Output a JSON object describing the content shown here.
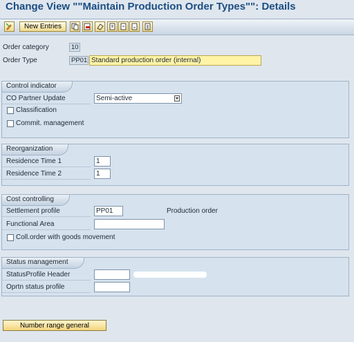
{
  "window": {
    "title": "Change View \"\"Maintain Production Order Types\"\": Details"
  },
  "toolbar": {
    "new_entries_label": "New Entries",
    "icons": [
      "edit-toggle-icon",
      "copy-icon",
      "delete-icon",
      "undo-icon",
      "first-entry-icon",
      "previous-entry-icon",
      "next-entry-icon",
      "last-entry-icon"
    ]
  },
  "header": {
    "order_category_label": "Order category",
    "order_category_value": "10",
    "order_type_label": "Order Type",
    "order_type_value": "PP01",
    "order_type_desc": "Standard production order (internal)"
  },
  "control_indicator": {
    "title": "Control indicator",
    "co_partner_label": "CO Partner Update",
    "co_partner_value": "Semi-active",
    "classification_label": "Classification",
    "classification_checked": false,
    "commit_label": "Commit. management",
    "commit_checked": false
  },
  "reorganization": {
    "title": "Reorganization",
    "res1_label": "Residence Time 1",
    "res1_value": "1",
    "res2_label": "Residence Time 2",
    "res2_value": "1"
  },
  "cost_controlling": {
    "title": "Cost controlling",
    "settlement_label": "Settlement profile",
    "settlement_value": "PP01",
    "settlement_desc": "Production order",
    "functional_label": "Functional Area",
    "functional_value": "",
    "coll_order_label": "Coll.order with goods movement",
    "coll_order_checked": false
  },
  "status_management": {
    "title": "Status management",
    "header_label": "StatusProfile Header",
    "header_value": "",
    "oprtn_label": "Oprtn status profile",
    "oprtn_value": ""
  },
  "footer": {
    "number_range_label": "Number range general"
  },
  "colors": {
    "title": "#1c4e82",
    "background": "#dfe6ee",
    "group": "#d6e2ee",
    "highlight": "#fff3a6"
  }
}
